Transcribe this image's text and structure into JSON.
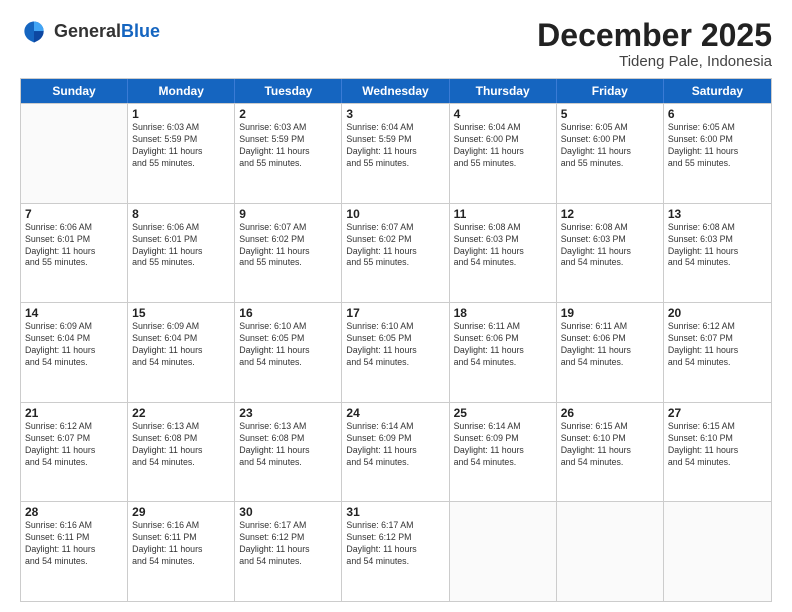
{
  "header": {
    "logo_general": "General",
    "logo_blue": "Blue",
    "main_title": "December 2025",
    "subtitle": "Tideng Pale, Indonesia"
  },
  "days_of_week": [
    "Sunday",
    "Monday",
    "Tuesday",
    "Wednesday",
    "Thursday",
    "Friday",
    "Saturday"
  ],
  "rows": [
    [
      {
        "day": "",
        "info": ""
      },
      {
        "day": "1",
        "info": "Sunrise: 6:03 AM\nSunset: 5:59 PM\nDaylight: 11 hours\nand 55 minutes."
      },
      {
        "day": "2",
        "info": "Sunrise: 6:03 AM\nSunset: 5:59 PM\nDaylight: 11 hours\nand 55 minutes."
      },
      {
        "day": "3",
        "info": "Sunrise: 6:04 AM\nSunset: 5:59 PM\nDaylight: 11 hours\nand 55 minutes."
      },
      {
        "day": "4",
        "info": "Sunrise: 6:04 AM\nSunset: 6:00 PM\nDaylight: 11 hours\nand 55 minutes."
      },
      {
        "day": "5",
        "info": "Sunrise: 6:05 AM\nSunset: 6:00 PM\nDaylight: 11 hours\nand 55 minutes."
      },
      {
        "day": "6",
        "info": "Sunrise: 6:05 AM\nSunset: 6:00 PM\nDaylight: 11 hours\nand 55 minutes."
      }
    ],
    [
      {
        "day": "7",
        "info": "Sunrise: 6:06 AM\nSunset: 6:01 PM\nDaylight: 11 hours\nand 55 minutes."
      },
      {
        "day": "8",
        "info": "Sunrise: 6:06 AM\nSunset: 6:01 PM\nDaylight: 11 hours\nand 55 minutes."
      },
      {
        "day": "9",
        "info": "Sunrise: 6:07 AM\nSunset: 6:02 PM\nDaylight: 11 hours\nand 55 minutes."
      },
      {
        "day": "10",
        "info": "Sunrise: 6:07 AM\nSunset: 6:02 PM\nDaylight: 11 hours\nand 55 minutes."
      },
      {
        "day": "11",
        "info": "Sunrise: 6:08 AM\nSunset: 6:03 PM\nDaylight: 11 hours\nand 54 minutes."
      },
      {
        "day": "12",
        "info": "Sunrise: 6:08 AM\nSunset: 6:03 PM\nDaylight: 11 hours\nand 54 minutes."
      },
      {
        "day": "13",
        "info": "Sunrise: 6:08 AM\nSunset: 6:03 PM\nDaylight: 11 hours\nand 54 minutes."
      }
    ],
    [
      {
        "day": "14",
        "info": "Sunrise: 6:09 AM\nSunset: 6:04 PM\nDaylight: 11 hours\nand 54 minutes."
      },
      {
        "day": "15",
        "info": "Sunrise: 6:09 AM\nSunset: 6:04 PM\nDaylight: 11 hours\nand 54 minutes."
      },
      {
        "day": "16",
        "info": "Sunrise: 6:10 AM\nSunset: 6:05 PM\nDaylight: 11 hours\nand 54 minutes."
      },
      {
        "day": "17",
        "info": "Sunrise: 6:10 AM\nSunset: 6:05 PM\nDaylight: 11 hours\nand 54 minutes."
      },
      {
        "day": "18",
        "info": "Sunrise: 6:11 AM\nSunset: 6:06 PM\nDaylight: 11 hours\nand 54 minutes."
      },
      {
        "day": "19",
        "info": "Sunrise: 6:11 AM\nSunset: 6:06 PM\nDaylight: 11 hours\nand 54 minutes."
      },
      {
        "day": "20",
        "info": "Sunrise: 6:12 AM\nSunset: 6:07 PM\nDaylight: 11 hours\nand 54 minutes."
      }
    ],
    [
      {
        "day": "21",
        "info": "Sunrise: 6:12 AM\nSunset: 6:07 PM\nDaylight: 11 hours\nand 54 minutes."
      },
      {
        "day": "22",
        "info": "Sunrise: 6:13 AM\nSunset: 6:08 PM\nDaylight: 11 hours\nand 54 minutes."
      },
      {
        "day": "23",
        "info": "Sunrise: 6:13 AM\nSunset: 6:08 PM\nDaylight: 11 hours\nand 54 minutes."
      },
      {
        "day": "24",
        "info": "Sunrise: 6:14 AM\nSunset: 6:09 PM\nDaylight: 11 hours\nand 54 minutes."
      },
      {
        "day": "25",
        "info": "Sunrise: 6:14 AM\nSunset: 6:09 PM\nDaylight: 11 hours\nand 54 minutes."
      },
      {
        "day": "26",
        "info": "Sunrise: 6:15 AM\nSunset: 6:10 PM\nDaylight: 11 hours\nand 54 minutes."
      },
      {
        "day": "27",
        "info": "Sunrise: 6:15 AM\nSunset: 6:10 PM\nDaylight: 11 hours\nand 54 minutes."
      }
    ],
    [
      {
        "day": "28",
        "info": "Sunrise: 6:16 AM\nSunset: 6:11 PM\nDaylight: 11 hours\nand 54 minutes."
      },
      {
        "day": "29",
        "info": "Sunrise: 6:16 AM\nSunset: 6:11 PM\nDaylight: 11 hours\nand 54 minutes."
      },
      {
        "day": "30",
        "info": "Sunrise: 6:17 AM\nSunset: 6:12 PM\nDaylight: 11 hours\nand 54 minutes."
      },
      {
        "day": "31",
        "info": "Sunrise: 6:17 AM\nSunset: 6:12 PM\nDaylight: 11 hours\nand 54 minutes."
      },
      {
        "day": "",
        "info": ""
      },
      {
        "day": "",
        "info": ""
      },
      {
        "day": "",
        "info": ""
      }
    ]
  ]
}
